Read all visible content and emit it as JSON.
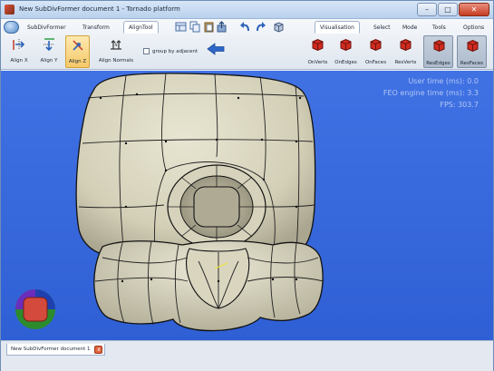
{
  "window": {
    "title": "New SubDivFormer document 1 - Tornado platform",
    "minimize_glyph": "–",
    "maximize_glyph": "□",
    "close_glyph": "✕"
  },
  "ribbon": {
    "tabs_left": [
      "SubDivFormer",
      "Transform",
      "AlignTool"
    ],
    "active_tab": "AlignTool",
    "tabs_right": [
      "Visualisation",
      "Select",
      "Mode",
      "Tools",
      "Options"
    ],
    "quick_access_icons": [
      "layout-icon",
      "copy-icon",
      "paste-icon",
      "export-icon",
      "undo-icon",
      "redo-icon",
      "cube-icon"
    ],
    "align_tools": [
      {
        "label": "Align X",
        "icon": "align-x-icon"
      },
      {
        "label": "Align Y",
        "icon": "align-y-icon"
      },
      {
        "label": "Align Z",
        "icon": "align-z-icon"
      },
      {
        "label": "Align Normals",
        "icon": "align-normals-icon",
        "glyph": "N"
      }
    ],
    "group_checkbox_label": "group by adjacent",
    "visualisation_tools": [
      {
        "label": "OnVerts",
        "pressed": false
      },
      {
        "label": "OnEdges",
        "pressed": false
      },
      {
        "label": "OnFaces",
        "pressed": false
      },
      {
        "label": "ResVerts",
        "pressed": false
      },
      {
        "label": "ResEdges",
        "pressed": true
      },
      {
        "label": "ResFaces",
        "pressed": true
      }
    ]
  },
  "viewport": {
    "stats": [
      "User time (ms): 0.0",
      "FEO engine time (ms): 3.3",
      "FPS: 303.7"
    ],
    "background_color": "#3467db",
    "mesh_color": "#dcd8c3"
  },
  "documents": {
    "tabs": [
      {
        "label": "New SubDivFormer document 1"
      }
    ],
    "close_glyph": "x"
  }
}
